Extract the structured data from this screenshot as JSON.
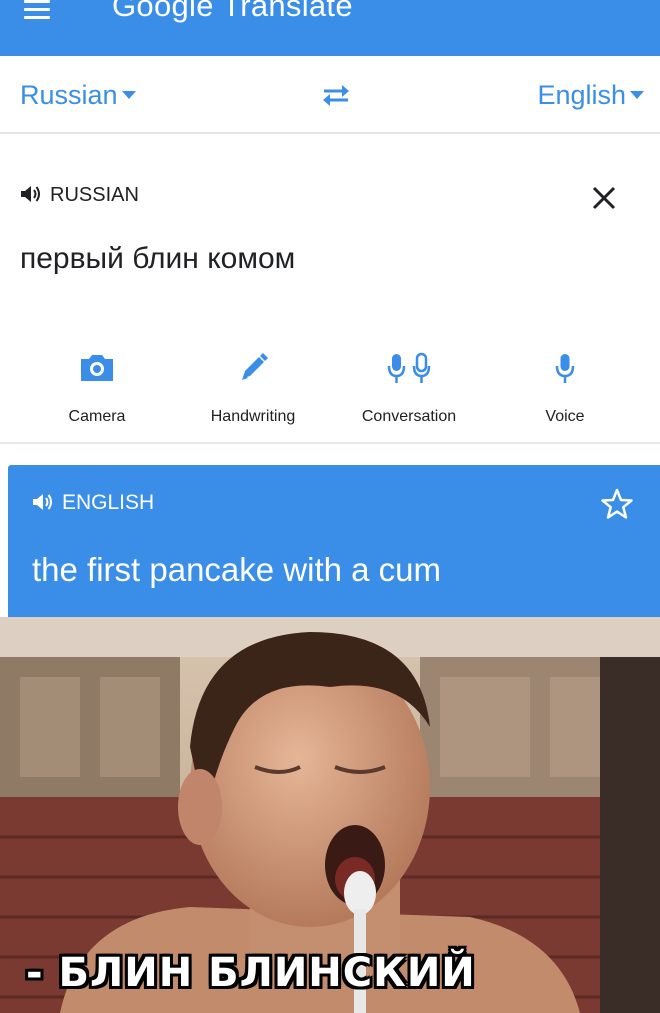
{
  "app_bar": {
    "title": "Google Translate",
    "menu_icon": "hamburger-menu-icon",
    "background_color": "#3a8ee8"
  },
  "language_bar": {
    "source_language": "Russian",
    "target_language": "English",
    "swap_icon": "swap-arrows-icon",
    "accent_color": "#3a8ee8"
  },
  "source_panel": {
    "language_label": "RUSSIAN",
    "speaker_icon": "speaker-icon",
    "close_icon": "close-icon",
    "input_text": "первый блин комом"
  },
  "input_tools": [
    {
      "label": "Camera",
      "icon": "camera-icon"
    },
    {
      "label": "Handwriting",
      "icon": "pen-icon"
    },
    {
      "label": "Conversation",
      "icon": "dual-microphone-icon"
    },
    {
      "label": "Voice",
      "icon": "microphone-icon"
    }
  ],
  "result_panel": {
    "language_label": "ENGLISH",
    "speaker_icon": "speaker-icon",
    "star_icon": "star-outline-icon",
    "translated_text": "the first pancake with a cum",
    "background_color": "#3a8ee8"
  },
  "meme": {
    "caption": "- БЛИН БЛИНСКИЙ"
  }
}
